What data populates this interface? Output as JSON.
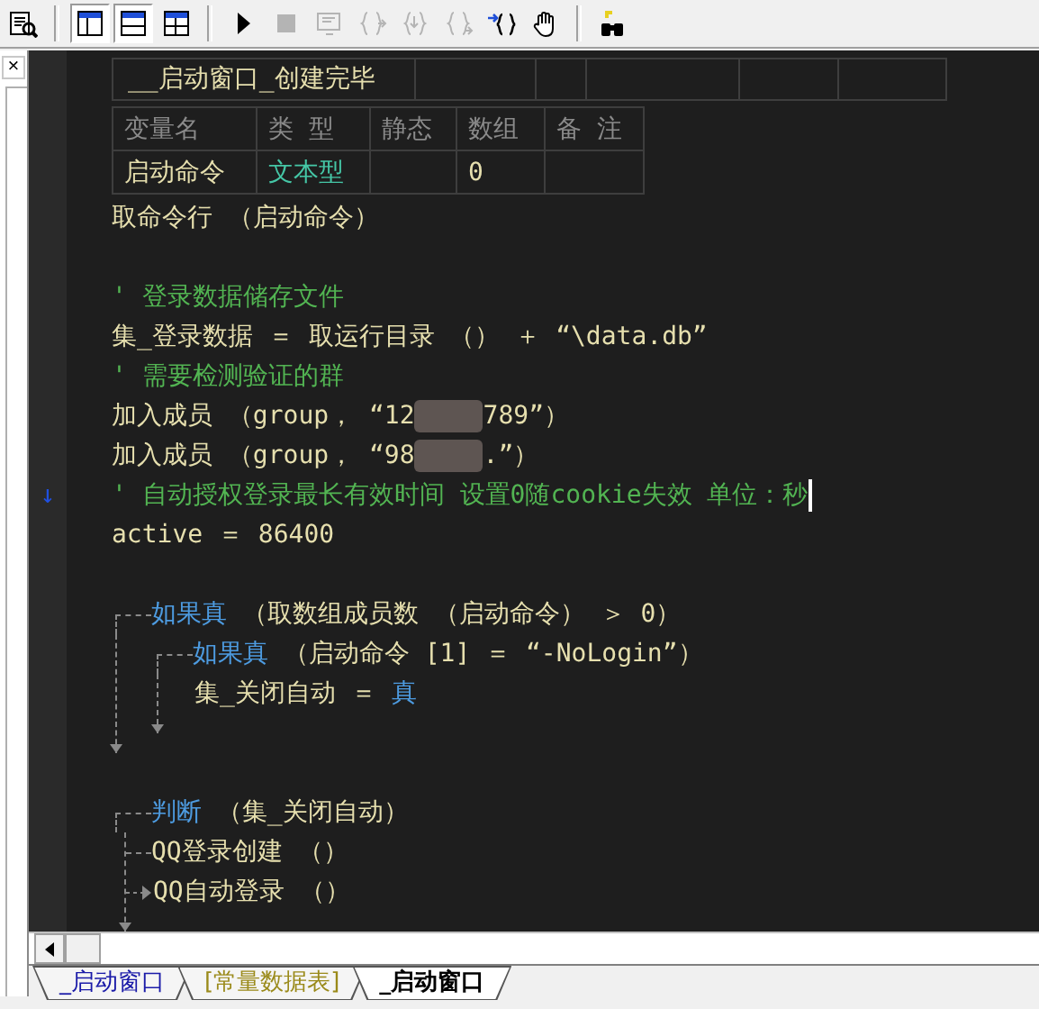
{
  "toolbar": {
    "buttons": [
      {
        "kind": "document-search",
        "pressed": false,
        "disabled": false
      },
      {
        "kind": "separator"
      },
      {
        "kind": "layout-split",
        "pressed": true,
        "disabled": false
      },
      {
        "kind": "layout-rows",
        "pressed": true,
        "disabled": false
      },
      {
        "kind": "layout-grid",
        "pressed": false,
        "disabled": false
      },
      {
        "kind": "separator"
      },
      {
        "kind": "play",
        "pressed": false,
        "disabled": false
      },
      {
        "kind": "stop",
        "pressed": false,
        "disabled": true
      },
      {
        "kind": "monitor",
        "pressed": false,
        "disabled": true
      },
      {
        "kind": "braces-right",
        "pressed": false,
        "disabled": true
      },
      {
        "kind": "braces-in",
        "pressed": false,
        "disabled": true
      },
      {
        "kind": "braces-out",
        "pressed": false,
        "disabled": true
      },
      {
        "kind": "arrow-braces",
        "pressed": false,
        "disabled": false
      },
      {
        "kind": "hand",
        "pressed": false,
        "disabled": false
      },
      {
        "kind": "separator"
      },
      {
        "kind": "binoculars",
        "pressed": false,
        "disabled": false
      }
    ]
  },
  "side_panel": {
    "close": "×"
  },
  "editor": {
    "header_table": {
      "title": "__启动窗口_创建完毕"
    },
    "var_table": {
      "columns": [
        "变量名",
        "类 型",
        "静态",
        "数组",
        "备 注"
      ],
      "rows": [
        {
          "name": "启动命令",
          "type": "文本型",
          "array": "0"
        }
      ]
    },
    "lines": [
      {
        "kind": "code",
        "segments": [
          {
            "text": "取命令行 （启动命令）",
            "kind": "plain"
          }
        ]
      },
      {
        "kind": "blank"
      },
      {
        "kind": "comment",
        "segments": [
          {
            "text": "' 登录数据储存文件",
            "kind": "comment"
          }
        ]
      },
      {
        "kind": "code",
        "segments": [
          {
            "text": "集_登录数据 ＝ 取运行目录 （） ＋ “\\data.db”",
            "kind": "plain"
          }
        ]
      },
      {
        "kind": "comment",
        "segments": [
          {
            "text": "' 需要检测验证的群",
            "kind": "comment"
          }
        ]
      },
      {
        "kind": "code",
        "segments": [
          {
            "text": "加入成员 （group， “12",
            "kind": "plain"
          },
          {
            "kind": "redacted"
          },
          {
            "text": "789”）",
            "kind": "plain"
          }
        ]
      },
      {
        "kind": "code",
        "segments": [
          {
            "text": "加入成员 （group， “98",
            "kind": "plain"
          },
          {
            "kind": "redacted"
          },
          {
            "text": ".”）",
            "kind": "plain"
          }
        ]
      },
      {
        "kind": "comment",
        "gutter": "↓",
        "caret": true,
        "segments": [
          {
            "text": "' 自动授权登录最长有效时间 设置0随cookie失效 单位：秒",
            "kind": "comment"
          }
        ]
      },
      {
        "kind": "code",
        "segments": [
          {
            "text": "active ＝ 86400",
            "kind": "plain"
          }
        ]
      },
      {
        "kind": "blank"
      },
      {
        "kind": "flow",
        "head": [
          {
            "text": "如果真",
            "kind": "keyword"
          },
          {
            "text": " （取数组成员数 （启动命令） ＞ 0）",
            "kind": "plain"
          }
        ],
        "children": [
          {
            "kind": "flow",
            "head": [
              {
                "text": "如果真",
                "kind": "keyword"
              },
              {
                "text": " （启动命令 [1] ＝ “-NoLogin”）",
                "kind": "plain"
              }
            ],
            "children": [
              {
                "kind": "code",
                "segments": [
                  {
                    "text": "集_关闭自动 ＝ ",
                    "kind": "plain"
                  },
                  {
                    "text": "真",
                    "kind": "keyword"
                  }
                ]
              }
            ]
          }
        ]
      },
      {
        "kind": "blank"
      },
      {
        "kind": "branch",
        "head": [
          {
            "text": "判断",
            "kind": "keyword"
          },
          {
            "text": " （集_关闭自动）",
            "kind": "plain"
          }
        ],
        "children": [
          {
            "kind": "code",
            "segments": [
              {
                "text": "QQ登录创建 （）",
                "kind": "plain"
              }
            ]
          },
          {
            "kind": "code",
            "segments": [
              {
                "text": "QQ自动登录 （）",
                "kind": "plain"
              }
            ]
          }
        ]
      }
    ]
  },
  "tabs": [
    {
      "label": "_启动窗口",
      "selected": false,
      "color": "#1a1aa8"
    },
    {
      "label": "[常量数据表]",
      "selected": false,
      "color": "#9a8a1a"
    },
    {
      "label": "_启动窗口",
      "selected": true,
      "color": "#000000"
    }
  ]
}
